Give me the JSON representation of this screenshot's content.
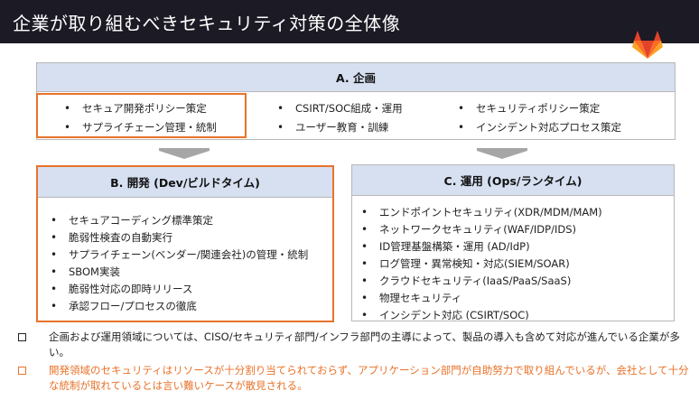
{
  "header": {
    "title": "企業が取り組むべきセキュリティ対策の全体像"
  },
  "logo": {
    "icon": "gitlab-tanuki-icon",
    "colors": [
      "#e24329",
      "#fc6d26",
      "#fca326"
    ]
  },
  "plan": {
    "title": "A. 企画",
    "col1": [
      "セキュア開発ポリシー策定",
      "サプライチェーン管理・統制"
    ],
    "col2": [
      "CSIRT/SOC組成・運用",
      "ユーザー教育・訓練"
    ],
    "col3": [
      "セキュリティポリシー策定",
      "インシデント対応プロセス策定"
    ]
  },
  "dev": {
    "title": "B. 開発 (Dev/ビルドタイム)",
    "items": [
      "セキュアコーディング標準策定",
      "脆弱性検査の自動実行",
      "サプライチェーン(ベンダー/関連会社)の管理・統制",
      "SBOM実装",
      "脆弱性対応の即時リリース",
      "承認フロー/プロセスの徹底"
    ]
  },
  "ops": {
    "title": "C. 運用 (Ops/ランタイム)",
    "items": [
      "エンドポイントセキュリティ(XDR/MDM/MAM)",
      "ネットワークセキュリティ(WAF/IDP/IDS)",
      "ID管理基盤構築・運用 (AD/IdP)",
      "ログ管理・異常検知・対応(SIEM/SOAR)",
      "クラウドセキュリティ(IaaS/PaaS/SaaS)",
      "物理セキュリティ",
      "インシデント対応 (CSIRT/SOC)"
    ]
  },
  "notes": [
    "企画および運用領域については、CISO/セキュリティ部門/インフラ部門の主導によって、製品の導入も含めて対応が進んでいる企業が多い。",
    "開発領域のセキュリティはリソースが十分割り当てられておらず、アプリケーション部門が自助努力で取り組んでいるが、会社として十分な統制が取れているとは言い難いケースが散見される。"
  ],
  "colors": {
    "accent": "#e8732a",
    "header_bg": "#1c1a24",
    "box_head": "#d6e0f1",
    "arrow": "#a6a6a6"
  }
}
